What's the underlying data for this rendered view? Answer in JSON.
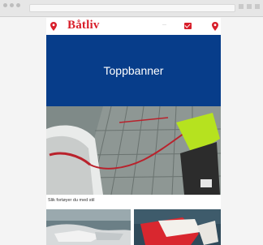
{
  "site": {
    "logo_text": "Båtliv"
  },
  "banner": {
    "label": "Toppbanner"
  },
  "article": {
    "caption": "Slik fortøyer du med stil"
  },
  "colors": {
    "brand_red": "#d81e2a",
    "banner_blue": "#073d8a"
  },
  "icons": [
    "location-pin-icon",
    "mail-icon"
  ]
}
